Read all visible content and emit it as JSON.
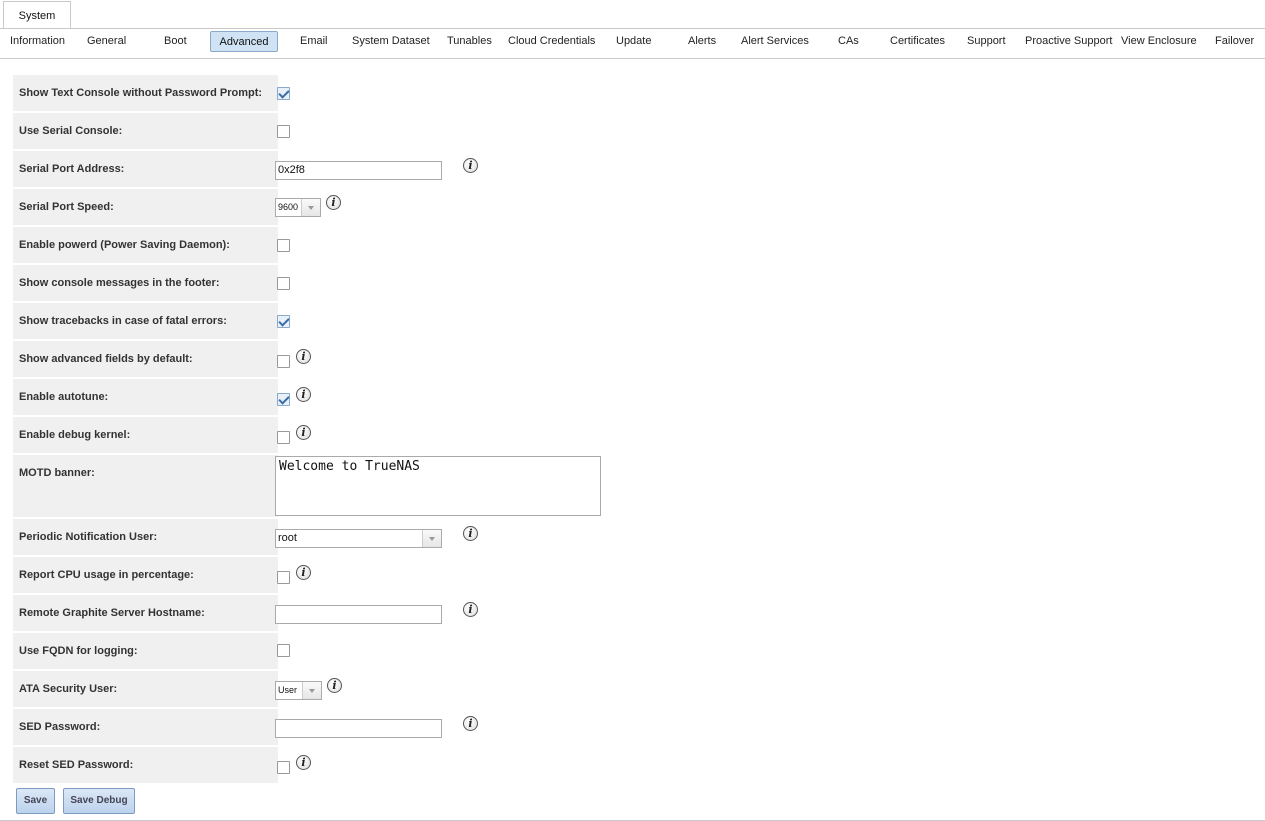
{
  "top_tab": "System",
  "tabs": [
    {
      "label": "Information"
    },
    {
      "label": "General"
    },
    {
      "label": "Boot"
    },
    {
      "label": "Advanced"
    },
    {
      "label": "Email"
    },
    {
      "label": "System Dataset"
    },
    {
      "label": "Tunables"
    },
    {
      "label": "Cloud Credentials"
    },
    {
      "label": "Update"
    },
    {
      "label": "Alerts"
    },
    {
      "label": "Alert Services"
    },
    {
      "label": "CAs"
    },
    {
      "label": "Certificates"
    },
    {
      "label": "Support"
    },
    {
      "label": "Proactive Support"
    },
    {
      "label": "View Enclosure"
    },
    {
      "label": "Failover"
    }
  ],
  "active_tab": "Advanced",
  "fields": {
    "text_console": {
      "label": "Show Text Console without Password Prompt:",
      "checked": true
    },
    "serial_console": {
      "label": "Use Serial Console:",
      "checked": false
    },
    "serial_port_address": {
      "label": "Serial Port Address:",
      "value": "0x2f8"
    },
    "serial_port_speed": {
      "label": "Serial Port Speed:",
      "value": "9600"
    },
    "powerd": {
      "label": "Enable powerd (Power Saving Daemon):",
      "checked": false
    },
    "console_msgs": {
      "label": "Show console messages in the footer:",
      "checked": false
    },
    "tracebacks": {
      "label": "Show tracebacks in case of fatal errors:",
      "checked": true
    },
    "advanced_fields": {
      "label": "Show advanced fields by default:",
      "checked": false
    },
    "autotune": {
      "label": "Enable autotune:",
      "checked": true
    },
    "debug_kernel": {
      "label": "Enable debug kernel:",
      "checked": false
    },
    "motd": {
      "label": "MOTD banner:",
      "value": "Welcome to TrueNAS"
    },
    "periodic_user": {
      "label": "Periodic Notification User:",
      "value": "root"
    },
    "cpu_percentage": {
      "label": "Report CPU usage in percentage:",
      "checked": false
    },
    "graphite": {
      "label": "Remote Graphite Server Hostname:",
      "value": ""
    },
    "fqdn_logging": {
      "label": "Use FQDN for logging:",
      "checked": false
    },
    "ata_user": {
      "label": "ATA Security User:",
      "value": "User"
    },
    "sed_password": {
      "label": "SED Password:",
      "value": ""
    },
    "reset_sed": {
      "label": "Reset SED Password:",
      "checked": false
    }
  },
  "buttons": {
    "save": "Save",
    "save_debug": "Save Debug"
  },
  "info_icon_glyph": "i",
  "colors": {
    "accent": "#cfe3f5",
    "label_bg": "#f0f0f0",
    "check": "#3a6ea5"
  }
}
